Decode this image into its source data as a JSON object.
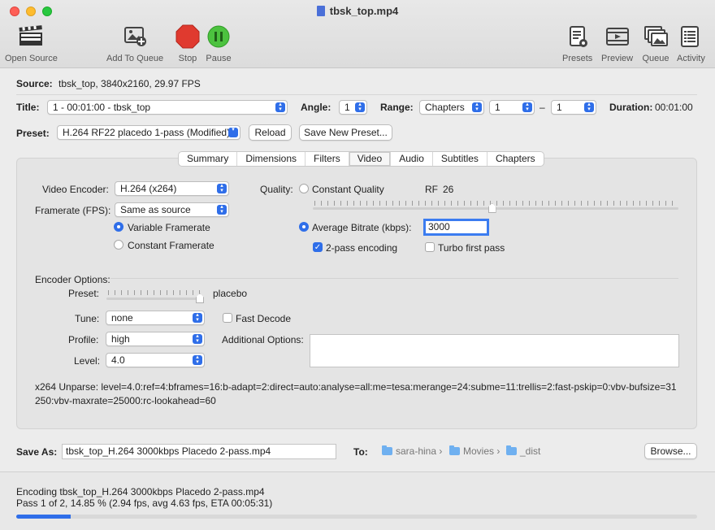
{
  "window": {
    "title": "tbsk_top.mp4"
  },
  "toolbar": {
    "open_source": "Open Source",
    "add_to_queue": "Add To Queue",
    "stop": "Stop",
    "pause": "Pause",
    "presets": "Presets",
    "preview": "Preview",
    "queue": "Queue",
    "activity": "Activity"
  },
  "source": {
    "label": "Source:",
    "value": "tbsk_top, 3840x2160, 29.97 FPS"
  },
  "title_row": {
    "title_label": "Title:",
    "title_value": "1 - 00:01:00 - tbsk_top",
    "angle_label": "Angle:",
    "angle_value": "1",
    "range_label": "Range:",
    "range_mode": "Chapters",
    "range_start": "1",
    "range_dash": "–",
    "range_end": "1",
    "duration_label": "Duration:",
    "duration_value": "00:01:00"
  },
  "preset_row": {
    "label": "Preset:",
    "value": "H.264 RF22 placedo 1-pass (Modified)",
    "reload": "Reload",
    "save_new": "Save New Preset..."
  },
  "tabs": [
    "Summary",
    "Dimensions",
    "Filters",
    "Video",
    "Audio",
    "Subtitles",
    "Chapters"
  ],
  "active_tab": "Video",
  "video": {
    "encoder_label": "Video Encoder:",
    "encoder_value": "H.264 (x264)",
    "framerate_label": "Framerate (FPS):",
    "framerate_value": "Same as source",
    "variable_framerate": "Variable Framerate",
    "constant_framerate": "Constant Framerate",
    "quality_label": "Quality:",
    "constant_quality": "Constant Quality",
    "rf_label": "RF",
    "rf_value": "26",
    "average_bitrate": "Average Bitrate (kbps):",
    "bitrate_value": "3000",
    "two_pass": "2-pass encoding",
    "turbo_first_pass": "Turbo first pass",
    "quality_slider_level": 0.49
  },
  "encoder_options": {
    "title": "Encoder Options:",
    "preset_label": "Preset:",
    "preset_value": "placebo",
    "preset_slider_level": 1.0,
    "tune_label": "Tune:",
    "tune_value": "none",
    "fast_decode": "Fast Decode",
    "profile_label": "Profile:",
    "profile_value": "high",
    "additional_label": "Additional Options:",
    "additional_value": "",
    "level_label": "Level:",
    "level_value": "4.0",
    "unparse": "x264 Unparse: level=4.0:ref=4:bframes=16:b-adapt=2:direct=auto:analyse=all:me=tesa:merange=24:subme=11:trellis=2:fast-pskip=0:vbv-bufsize=31250:vbv-maxrate=25000:rc-lookahead=60"
  },
  "save": {
    "label": "Save As:",
    "value": "tbsk_top_H.264 3000kbps Placedo 2-pass.mp4",
    "to_label": "To:",
    "path": [
      "sara-hina",
      "Movies",
      "_dist"
    ],
    "browse": "Browse..."
  },
  "status": {
    "line1": "Encoding tbsk_top_H.264 3000kbps Placedo 2-pass.mp4",
    "line2": "Pass 1 of 2, 14.85 % (2.94 fps, avg 4.63 fps, ETA 00:05:31)",
    "progress": 0.08
  },
  "colors": {
    "accent": "#2f6ee9",
    "stop": "#e03a2f",
    "pause": "#4cc23f"
  }
}
